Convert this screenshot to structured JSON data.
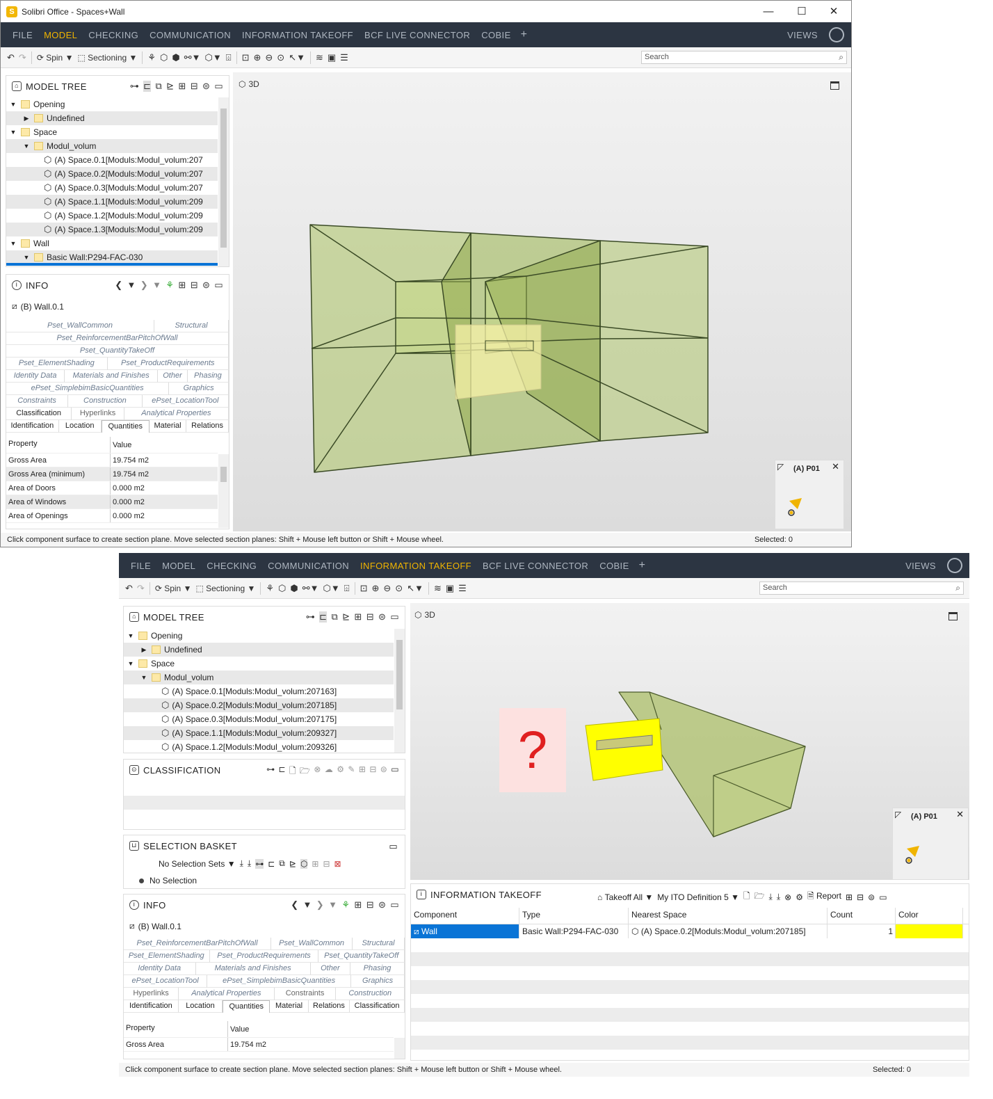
{
  "window1": {
    "title": "Solibri Office - Spaces+Wall",
    "menu": [
      "FILE",
      "MODEL",
      "CHECKING",
      "COMMUNICATION",
      "INFORMATION TAKEOFF",
      "BCF LIVE CONNECTOR",
      "COBIE"
    ],
    "active_menu": "MODEL",
    "views_label": "VIEWS",
    "toolbar": {
      "spin": "Spin",
      "sectioning": "Sectioning",
      "search_placeholder": "Search"
    },
    "model_tree": {
      "title": "MODEL TREE",
      "rows": [
        {
          "indent": 0,
          "expand": "▼",
          "kind": "folder",
          "label": "Opening"
        },
        {
          "indent": 1,
          "expand": "▶",
          "kind": "folder",
          "label": "Undefined"
        },
        {
          "indent": 0,
          "expand": "▼",
          "kind": "folder",
          "label": "Space"
        },
        {
          "indent": 1,
          "expand": "▼",
          "kind": "folder",
          "label": "Modul_volum"
        },
        {
          "indent": 2,
          "expand": "",
          "kind": "cube",
          "label": "(A) Space.0.1[Moduls:Modul_volum:207"
        },
        {
          "indent": 2,
          "expand": "",
          "kind": "cube",
          "label": "(A) Space.0.2[Moduls:Modul_volum:207"
        },
        {
          "indent": 2,
          "expand": "",
          "kind": "cube",
          "label": "(A) Space.0.3[Moduls:Modul_volum:207"
        },
        {
          "indent": 2,
          "expand": "",
          "kind": "cube",
          "label": "(A) Space.1.1[Moduls:Modul_volum:209"
        },
        {
          "indent": 2,
          "expand": "",
          "kind": "cube",
          "label": "(A) Space.1.2[Moduls:Modul_volum:209"
        },
        {
          "indent": 2,
          "expand": "",
          "kind": "cube",
          "label": "(A) Space.1.3[Moduls:Modul_volum:209"
        },
        {
          "indent": 0,
          "expand": "▼",
          "kind": "folder",
          "label": "Wall"
        },
        {
          "indent": 1,
          "expand": "▼",
          "kind": "folder",
          "label": "Basic Wall:P294-FAC-030"
        }
      ]
    },
    "info": {
      "title": "INFO",
      "component": "(B) Wall.0.1",
      "tab_rows": [
        [
          {
            "t": "Pset_WallCommon",
            "s": "i",
            "w": 2
          },
          {
            "t": "Structural",
            "s": "i",
            "w": 1
          }
        ],
        [
          {
            "t": "Pset_ReinforcementBarPitchOfWall",
            "s": "i",
            "w": 1
          }
        ],
        [
          {
            "t": "Pset_QuantityTakeOff",
            "s": "i",
            "w": 1
          }
        ],
        [
          {
            "t": "Pset_ElementShading",
            "s": "i",
            "w": 1
          },
          {
            "t": "Pset_ProductRequirements",
            "s": "i",
            "w": 1.2
          }
        ],
        [
          {
            "t": "Identity Data",
            "s": "i",
            "w": 1
          },
          {
            "t": "Materials and Finishes",
            "s": "i",
            "w": 1.6
          },
          {
            "t": "Other",
            "s": "i",
            "w": 0.5
          },
          {
            "t": "Phasing",
            "s": "i",
            "w": 0.7
          }
        ],
        [
          {
            "t": "ePset_SimplebimBasicQuantities",
            "s": "i",
            "w": 2.2
          },
          {
            "t": "Graphics",
            "s": "i",
            "w": 0.8
          }
        ],
        [
          {
            "t": "Constraints",
            "s": "i",
            "w": 1
          },
          {
            "t": "Construction",
            "s": "i",
            "w": 1.2
          },
          {
            "t": "ePset_LocationTool",
            "s": "i",
            "w": 1.4
          }
        ],
        [
          {
            "t": "Classification",
            "s": "p",
            "w": 1
          },
          {
            "t": "Hyperlinks",
            "s": "d",
            "w": 0.8
          },
          {
            "t": "Analytical Properties",
            "s": "i",
            "w": 1.6
          }
        ],
        [
          {
            "t": "Identification",
            "s": "p",
            "w": 1
          },
          {
            "t": "Location",
            "s": "p",
            "w": 0.8
          },
          {
            "t": "Quantities",
            "s": "a",
            "w": 0.9
          },
          {
            "t": "Material",
            "s": "p",
            "w": 0.7
          },
          {
            "t": "Relations",
            "s": "p",
            "w": 0.8
          }
        ]
      ],
      "columns": [
        "Property",
        "Value"
      ],
      "rows": [
        [
          "Gross Area",
          "19.754 m2"
        ],
        [
          "Gross Area (minimum)",
          "19.754 m2"
        ],
        [
          "Area of Doors",
          "0.000 m2"
        ],
        [
          "Area of Windows",
          "0.000 m2"
        ],
        [
          "Area of Openings",
          "0.000 m2"
        ]
      ]
    },
    "view3d_label": "3D",
    "minimap_label": "(A) P01",
    "status": "Click component surface to create section plane. Move selected section planes: Shift + Mouse left button or Shift + Mouse wheel.",
    "selected": "Selected: 0"
  },
  "window2": {
    "menu": [
      "FILE",
      "MODEL",
      "CHECKING",
      "COMMUNICATION",
      "INFORMATION TAKEOFF",
      "BCF LIVE CONNECTOR",
      "COBIE"
    ],
    "active_menu": "INFORMATION TAKEOFF",
    "views_label": "VIEWS",
    "toolbar": {
      "spin": "Spin",
      "sectioning": "Sectioning",
      "search_placeholder": "Search"
    },
    "model_tree": {
      "title": "MODEL TREE",
      "rows": [
        {
          "indent": 0,
          "expand": "▼",
          "kind": "folder",
          "label": "Opening"
        },
        {
          "indent": 1,
          "expand": "▶",
          "kind": "folder",
          "label": "Undefined"
        },
        {
          "indent": 0,
          "expand": "▼",
          "kind": "folder",
          "label": "Space"
        },
        {
          "indent": 1,
          "expand": "▼",
          "kind": "folder",
          "label": "Modul_volum"
        },
        {
          "indent": 2,
          "expand": "",
          "kind": "cube",
          "label": "(A) Space.0.1[Moduls:Modul_volum:207163]"
        },
        {
          "indent": 2,
          "expand": "",
          "kind": "cube",
          "label": "(A) Space.0.2[Moduls:Modul_volum:207185]"
        },
        {
          "indent": 2,
          "expand": "",
          "kind": "cube",
          "label": "(A) Space.0.3[Moduls:Modul_volum:207175]"
        },
        {
          "indent": 2,
          "expand": "",
          "kind": "cube",
          "label": "(A) Space.1.1[Moduls:Modul_volum:209327]"
        },
        {
          "indent": 2,
          "expand": "",
          "kind": "cube",
          "label": "(A) Space.1.2[Moduls:Modul_volum:209326]"
        }
      ]
    },
    "classification_title": "CLASSIFICATION",
    "basket": {
      "title": "SELECTION BASKET",
      "sets": "No Selection Sets",
      "selection": "No Selection"
    },
    "info": {
      "title": "INFO",
      "component": "(B) Wall.0.1",
      "tab_rows": [
        [
          {
            "t": "Pset_ReinforcementBarPitchOfWall",
            "s": "i",
            "w": 2
          },
          {
            "t": "Pset_WallCommon",
            "s": "i",
            "w": 1.1
          },
          {
            "t": "Structural",
            "s": "i",
            "w": 0.7
          }
        ],
        [
          {
            "t": "Pset_ElementShading",
            "s": "i",
            "w": 1.1
          },
          {
            "t": "Pset_ProductRequirements",
            "s": "i",
            "w": 1.4
          },
          {
            "t": "Pset_QuantityTakeOff",
            "s": "i",
            "w": 1.1
          }
        ],
        [
          {
            "t": "Identity Data",
            "s": "i",
            "w": 1
          },
          {
            "t": "Materials and Finishes",
            "s": "i",
            "w": 1.6
          },
          {
            "t": "Other",
            "s": "i",
            "w": 0.55
          },
          {
            "t": "Phasing",
            "s": "i",
            "w": 0.75
          }
        ],
        [
          {
            "t": "ePset_LocationTool",
            "s": "i",
            "w": 1.1
          },
          {
            "t": "ePset_SimplebimBasicQuantities",
            "s": "i",
            "w": 1.9
          },
          {
            "t": "Graphics",
            "s": "i",
            "w": 0.7
          }
        ],
        [
          {
            "t": "Hyperlinks",
            "s": "d",
            "w": 0.8
          },
          {
            "t": "Analytical Properties",
            "s": "i",
            "w": 1.4
          },
          {
            "t": "Constraints",
            "s": "d",
            "w": 0.9
          },
          {
            "t": "Construction",
            "s": "i",
            "w": 1
          }
        ],
        [
          {
            "t": "Identification",
            "s": "p",
            "w": 1
          },
          {
            "t": "Location",
            "s": "p",
            "w": 0.8
          },
          {
            "t": "Quantities",
            "s": "a",
            "w": 0.85
          },
          {
            "t": "Material",
            "s": "p",
            "w": 0.7
          },
          {
            "t": "Relations",
            "s": "p",
            "w": 0.75
          },
          {
            "t": "Classification",
            "s": "p",
            "w": 1
          }
        ]
      ],
      "columns": [
        "Property",
        "Value"
      ],
      "rows": [
        [
          "Gross Area",
          "19.754 m2"
        ]
      ]
    },
    "view3d_label": "3D",
    "question_mark": "?",
    "minimap_label": "(A) P01",
    "ito": {
      "title": "INFORMATION TAKEOFF",
      "takeoff_all": "Takeoff All",
      "definition": "My ITO Definition 5",
      "report": "Report",
      "columns": [
        "Component",
        "Type",
        "Nearest Space",
        "Count",
        "Color"
      ],
      "row": {
        "component": "Wall",
        "type": "Basic Wall:P294-FAC-030",
        "nearest_space": "(A) Space.0.2[Moduls:Modul_volum:207185]",
        "count": "1",
        "color": "#ffff00"
      }
    },
    "status": "Click component surface to create section plane. Move selected section planes: Shift + Mouse left button or Shift + Mouse wheel.",
    "selected": "Selected: 0"
  },
  "colors": {
    "menubar": "#2c3542",
    "active_menu": "#f0b400",
    "selection": "#0a74d6",
    "space_fill": "#a8c060",
    "wall_fill": "#ffff00"
  }
}
